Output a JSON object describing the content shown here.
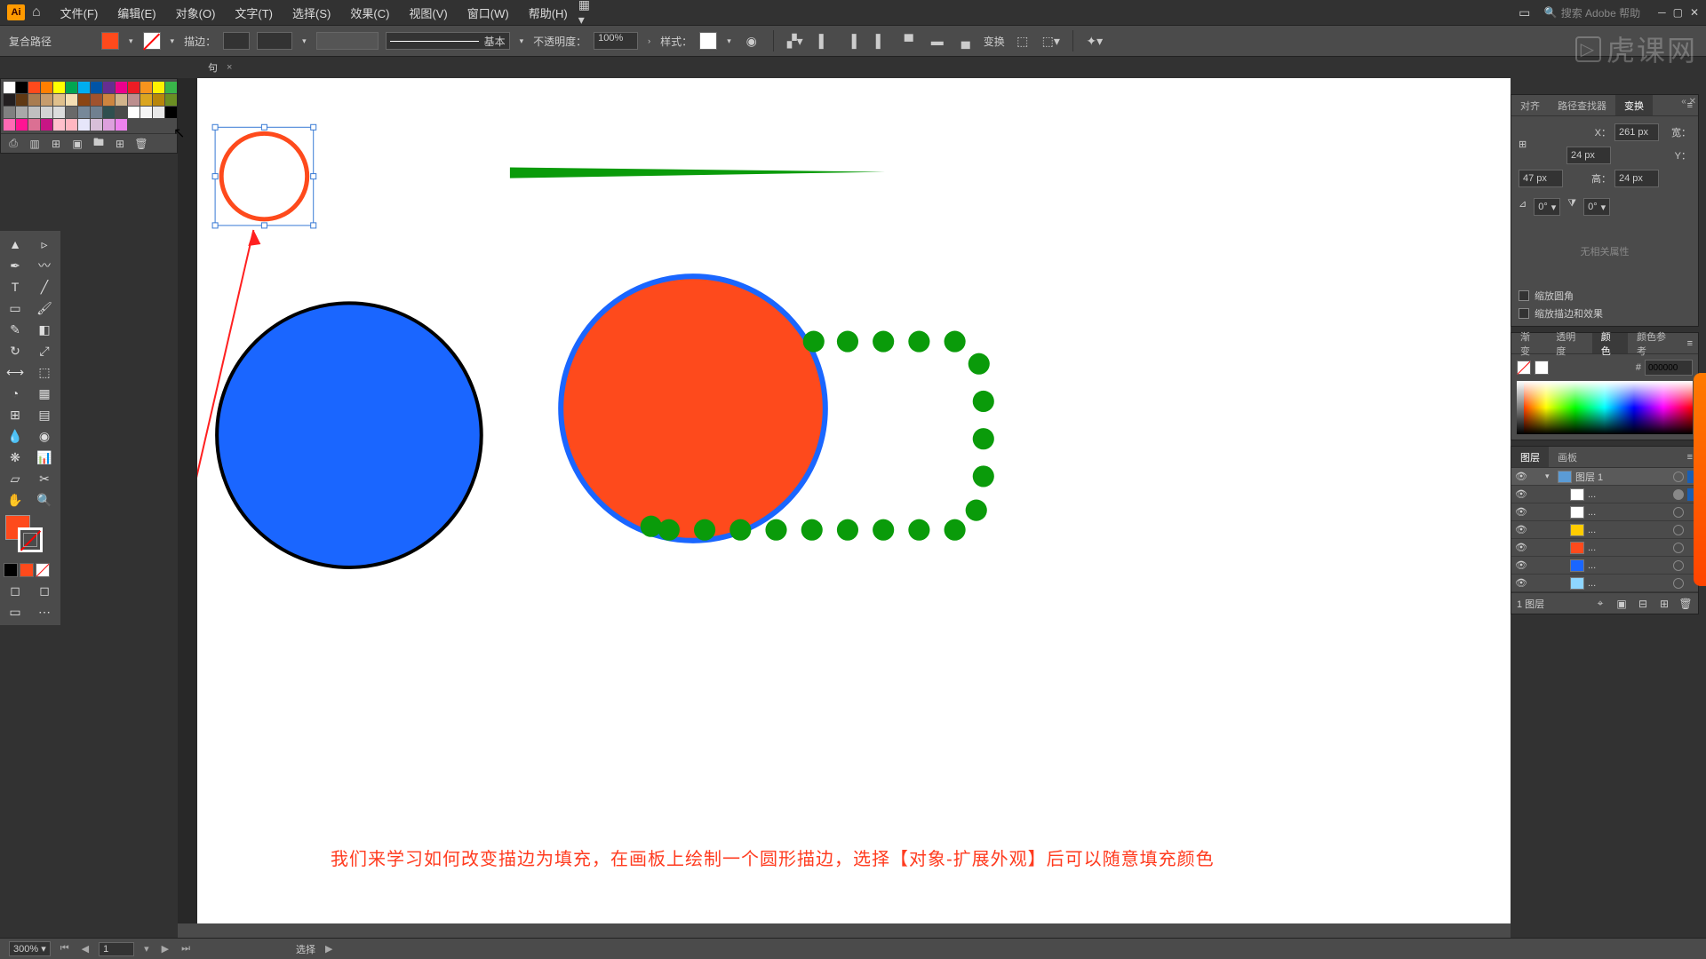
{
  "menu": {
    "file": "文件(F)",
    "edit": "编辑(E)",
    "object": "对象(O)",
    "type": "文字(T)",
    "select": "选择(S)",
    "effect": "效果(C)",
    "view": "视图(V)",
    "window": "窗口(W)",
    "help": "帮助(H)"
  },
  "search_placeholder": "搜索 Adobe 帮助",
  "optbar": {
    "mode": "复合路径",
    "stroke_label": "描边：",
    "stroke_preset": "基本",
    "opacity_label": "不透明度：",
    "opacity_value": "100%",
    "style_label": "样式：",
    "transform_label": "变换"
  },
  "doc_tab": {
    "name": "句",
    "close": "×"
  },
  "transform": {
    "tabs": {
      "align": "对齐",
      "pathfinder": "路径查找器",
      "transform": "变换"
    },
    "x_label": "X：",
    "x_val": "261 px",
    "w_label": "宽：",
    "w_val": "24 px",
    "y_label": "Y：",
    "y_val": "47 px",
    "h_label": "高：",
    "h_val": "24 px",
    "angle1": "0°",
    "angle2": "0°",
    "empty": "无相关属性",
    "chk1": "缩放圆角",
    "chk2": "缩放描边和效果"
  },
  "color": {
    "tabs": {
      "grad": "渐变",
      "transp": "透明度",
      "color": "颜色",
      "guide": "颜色参考"
    },
    "hex_prefix": "#",
    "hex_value": "000000"
  },
  "layers": {
    "tabs": {
      "layers": "图层",
      "artboards": "画板"
    },
    "rows": [
      {
        "name": "图层 1",
        "color": "#5b9bd5",
        "top": true,
        "twist": "▾"
      },
      {
        "name": "...",
        "color": "#ffffff",
        "thumb": "circle-outline"
      },
      {
        "name": "...",
        "color": "#ffffff"
      },
      {
        "name": "...",
        "color": "#ffcc00"
      },
      {
        "name": "...",
        "color": "#fe4a1c"
      },
      {
        "name": "...",
        "color": "#1a66ff"
      },
      {
        "name": "...",
        "color": "#8ed6ff"
      }
    ],
    "count": "1 图层"
  },
  "status": {
    "zoom": "300%",
    "page": "1",
    "tool": "选择"
  },
  "caption": "我们来学习如何改变描边为填充，在画板上绘制一个圆形描边，选择【对象-扩展外观】后可以随意填充颜色",
  "watermark": "虎课网",
  "swatches": [
    "#ffffff",
    "#000000",
    "#fe4a1c",
    "#ff7f00",
    "#ffff00",
    "#00a651",
    "#00aeef",
    "#0054a6",
    "#662d91",
    "#ec008c",
    "#ed1c24",
    "#f7941d",
    "#fff200",
    "#39b54a",
    "#231f20",
    "#603913",
    "#a97c50",
    "#c69c6d",
    "#e0c08c",
    "#f5deb3",
    "#8b4513",
    "#a0522d",
    "#cd853f",
    "#d2b48c",
    "#bc8f8f",
    "#daa520",
    "#b8860b",
    "#6b8e23",
    "#808080",
    "#a9a9a9",
    "#c0c0c0",
    "#d3d3d3",
    "#dcdcdc",
    "#696969",
    "#778899",
    "#708090",
    "#2f4f4f",
    "#4b4b4b",
    "#ffffff",
    "#f5f5f5",
    "#e8e8e8",
    "#000000",
    "#ff69b4",
    "#ff1493",
    "#db7093",
    "#c71585",
    "#ffc0cb",
    "#ffb6c1",
    "#e6e6fa",
    "#d8bfd8",
    "#dda0dd",
    "#ee82ee"
  ]
}
